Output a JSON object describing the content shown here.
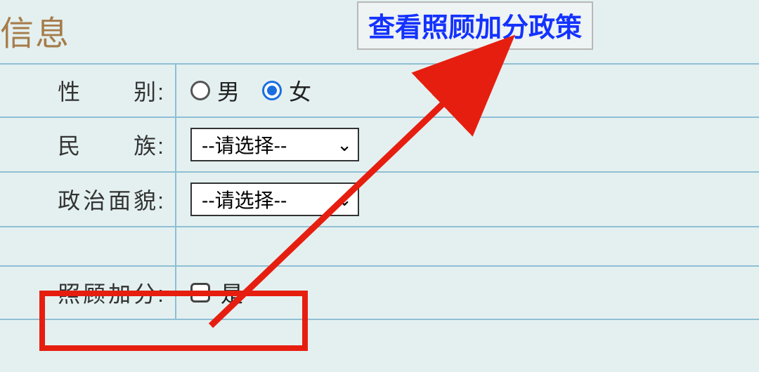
{
  "section_title": "信息",
  "policy_button_label": "查看照顾加分政策",
  "fields": {
    "gender": {
      "label": "性别",
      "option_male": "男",
      "option_female": "女",
      "selected": "female"
    },
    "ethnicity": {
      "label": "民族",
      "placeholder": "--请选择--"
    },
    "political": {
      "label": "政治面貌",
      "placeholder": "--请选择--"
    },
    "bonus": {
      "label": "照顾加分",
      "option_yes": "是",
      "checked": false
    }
  },
  "colors": {
    "accent_link": "#1432ff",
    "highlight": "#e61e10",
    "radio_selected": "#1a6fe0"
  }
}
